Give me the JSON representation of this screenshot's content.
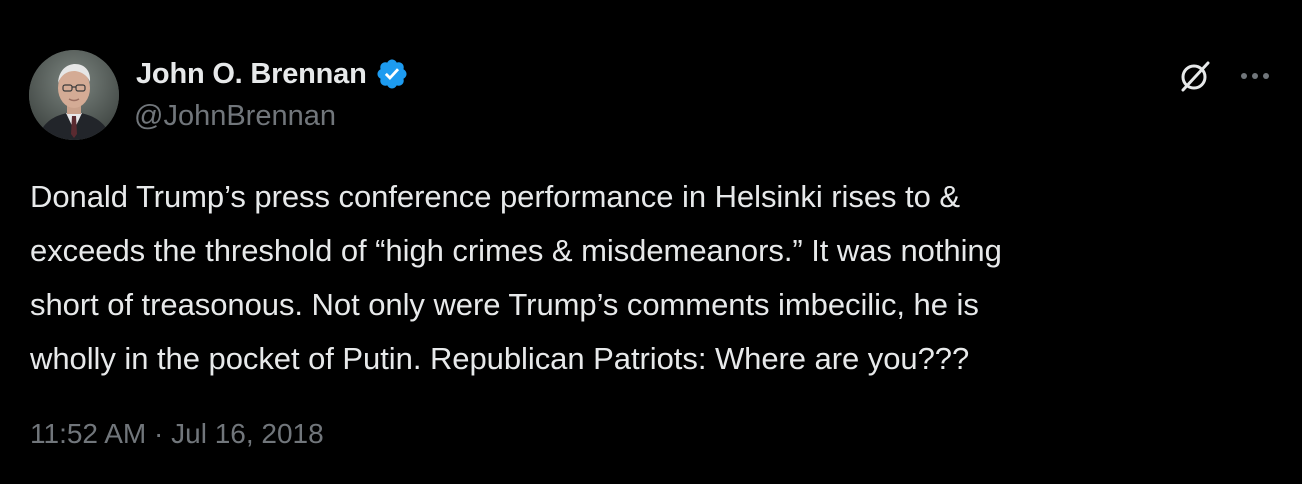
{
  "author": {
    "display_name": "John O. Brennan",
    "handle": "@JohnBrennan",
    "verified": true,
    "verified_color": "#1d9bf0",
    "avatar": "profile-photo"
  },
  "header_actions": {
    "grok_icon": "grok-slash-icon",
    "more_icon": "more-horizontal-icon"
  },
  "tweet": {
    "text": "Donald Trump’s press conference performance in Helsinki rises to &\nexceeds the threshold of “high crimes & misdemeanors.” It was nothing\nshort of treasonous. Not only were Trump’s comments imbecilic, he is\nwholly in the pocket of Putin. Republican Patriots: Where are you???",
    "time": "11:52 AM",
    "separator": " · ",
    "date": "Jul 16, 2018"
  },
  "colors": {
    "background": "#000000",
    "primary_text": "#e7e9ea",
    "secondary_text": "#71767b"
  }
}
